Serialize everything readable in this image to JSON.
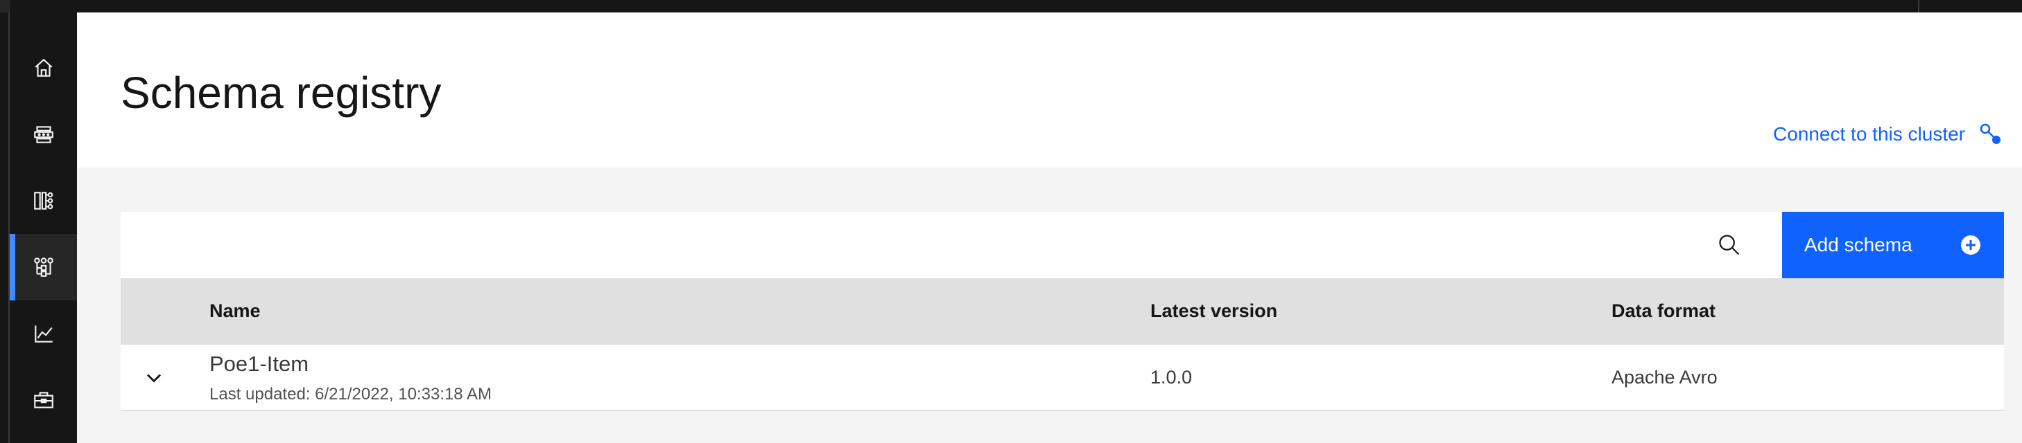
{
  "page": {
    "title": "Schema registry",
    "connect_link": "Connect to this cluster"
  },
  "sidenav": {
    "items": [
      {
        "name": "home",
        "icon": "home-icon",
        "active": false
      },
      {
        "name": "topics",
        "icon": "data-structure-icon",
        "active": false
      },
      {
        "name": "consumer-groups",
        "icon": "hierarchy-icon",
        "active": false
      },
      {
        "name": "schema-registry",
        "icon": "schema-tree-icon",
        "active": true
      },
      {
        "name": "monitoring",
        "icon": "chart-line-icon",
        "active": false
      },
      {
        "name": "toolbox",
        "icon": "toolbox-icon",
        "active": false
      }
    ]
  },
  "toolbar": {
    "search_icon": "search-icon",
    "add_label": "Add schema",
    "add_icon": "add-filled-icon"
  },
  "table": {
    "columns": [
      "Name",
      "Latest version",
      "Data format"
    ],
    "rows": [
      {
        "name": "Poe1-Item",
        "updated": "Last updated: 6/21/2022, 10:33:18 AM",
        "version": "1.0.0",
        "format": "Apache Avro"
      }
    ]
  },
  "colors": {
    "accent": "#0f62fe",
    "nav_bg": "#161616",
    "nav_active": "#4589ff",
    "content_bg": "#f4f4f4",
    "header_row": "#e0e0e0"
  }
}
